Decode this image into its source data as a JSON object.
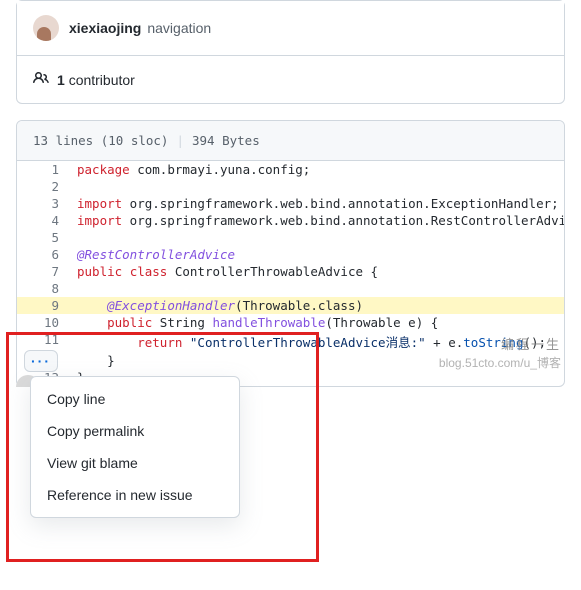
{
  "commit": {
    "author": "xiexiaojing",
    "message": "navigation"
  },
  "contributors": {
    "count": "1",
    "label": "contributor"
  },
  "file_meta": {
    "lines": "13 lines (10 sloc)",
    "size": "394 Bytes"
  },
  "chart_data": {
    "type": "table",
    "language": "java",
    "highlighted_line": 9,
    "lines": [
      {
        "n": 1,
        "tokens": [
          [
            "k-pkg",
            "package"
          ],
          [
            "",
            " com.brmayi.yuna.config;"
          ]
        ]
      },
      {
        "n": 2,
        "tokens": []
      },
      {
        "n": 3,
        "tokens": [
          [
            "k-imp",
            "import"
          ],
          [
            "",
            " org.springframework.web.bind.annotation.ExceptionHandler;"
          ]
        ]
      },
      {
        "n": 4,
        "tokens": [
          [
            "k-imp",
            "import"
          ],
          [
            "",
            " org.springframework.web.bind.annotation.RestControllerAdvice;"
          ]
        ]
      },
      {
        "n": 5,
        "tokens": []
      },
      {
        "n": 6,
        "tokens": [
          [
            "k-anno",
            "@RestControllerAdvice"
          ]
        ]
      },
      {
        "n": 7,
        "tokens": [
          [
            "k-mod",
            "public"
          ],
          [
            "",
            " "
          ],
          [
            "k-mod",
            "class"
          ],
          [
            "",
            " "
          ],
          [
            "k-type",
            "ControllerThrowableAdvice"
          ],
          [
            "",
            " {"
          ]
        ]
      },
      {
        "n": 8,
        "tokens": []
      },
      {
        "n": 9,
        "tokens": [
          [
            "",
            "    "
          ],
          [
            "k-anno",
            "@ExceptionHandler"
          ],
          [
            "",
            "("
          ],
          [
            "k-type",
            "Throwable"
          ],
          [
            "",
            ".class)"
          ]
        ]
      },
      {
        "n": 10,
        "tokens": [
          [
            "",
            "    "
          ],
          [
            "k-mod",
            "public"
          ],
          [
            "",
            " "
          ],
          [
            "k-type",
            "String"
          ],
          [
            "",
            " "
          ],
          [
            "k-method",
            "handleThrowable"
          ],
          [
            "",
            "("
          ],
          [
            "k-type",
            "Throwable"
          ],
          [
            "",
            " e) {"
          ]
        ]
      },
      {
        "n": 11,
        "tokens": [
          [
            "",
            "        "
          ],
          [
            "k-mod",
            "return"
          ],
          [
            "",
            " "
          ],
          [
            "k-str",
            "\"ControllerThrowableAdvice消息:\""
          ],
          [
            "",
            " + e."
          ],
          [
            "k-call",
            "toString"
          ],
          [
            "",
            "();"
          ]
        ]
      },
      {
        "n": 12,
        "tokens": [
          [
            "",
            "    }"
          ]
        ]
      },
      {
        "n": 13,
        "tokens": [
          [
            "",
            "}"
          ]
        ]
      }
    ]
  },
  "menu": {
    "items": [
      "Copy line",
      "Copy permalink",
      "View git blame",
      "Reference in new issue"
    ]
  },
  "watermark1": "编程一生",
  "watermark2": "blog.51cto.com/u_博客"
}
